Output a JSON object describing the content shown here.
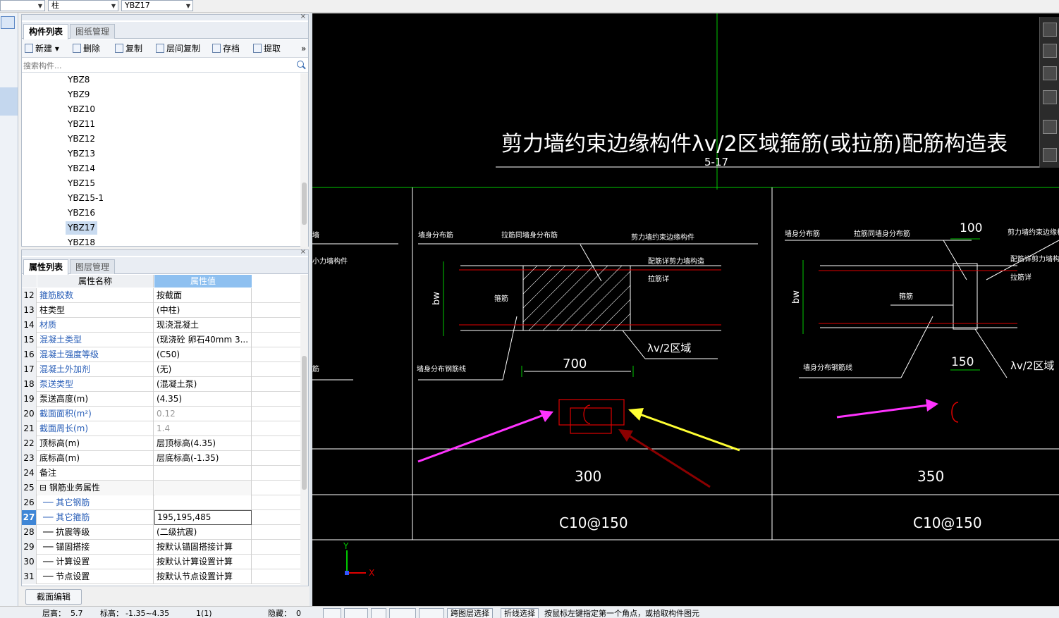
{
  "topbar": {
    "combo_floor": "",
    "combo_type": "柱",
    "combo_component": "YBZ17"
  },
  "component_panel": {
    "tabs": [
      "构件列表",
      "图纸管理"
    ],
    "toolbar": {
      "new": "新建",
      "delete": "删除",
      "copy": "复制",
      "floor_copy": "层间复制",
      "save": "存档",
      "extract": "提取",
      "more": "»"
    },
    "search_placeholder": "搜索构件...",
    "components": [
      "YBZ8",
      "YBZ9",
      "YBZ10",
      "YBZ11",
      "YBZ12",
      "YBZ13",
      "YBZ14",
      "YBZ15",
      "YBZ15-1",
      "YBZ16",
      "YBZ17",
      "YBZ18"
    ],
    "selected": "YBZ17"
  },
  "property_panel": {
    "tabs": [
      "属性列表",
      "图层管理"
    ],
    "headers": {
      "name": "属性名称",
      "value": "属性值"
    },
    "rows": [
      {
        "n": "12",
        "name": "箍筋胶数",
        "value": "按截面",
        "blue": true
      },
      {
        "n": "13",
        "name": "柱类型",
        "value": "(中柱)"
      },
      {
        "n": "14",
        "name": "材质",
        "value": "现浇混凝土",
        "blue": true
      },
      {
        "n": "15",
        "name": "混凝土类型",
        "value": "(现浇砼 卵石40mm 3...",
        "blue": true
      },
      {
        "n": "16",
        "name": "混凝土强度等级",
        "value": "(C50)",
        "blue": true
      },
      {
        "n": "17",
        "name": "混凝土外加剂",
        "value": "(无)",
        "blue": true
      },
      {
        "n": "18",
        "name": "泵送类型",
        "value": "(混凝土泵)",
        "blue": true
      },
      {
        "n": "19",
        "name": "泵送高度(m)",
        "value": "(4.35)"
      },
      {
        "n": "20",
        "name": "截面面积(m²)",
        "value": "0.12",
        "blue": true,
        "gray": true
      },
      {
        "n": "21",
        "name": "截面周长(m)",
        "value": "1.4",
        "blue": true,
        "gray": true
      },
      {
        "n": "22",
        "name": "顶标高(m)",
        "value": "层顶标高(4.35)"
      },
      {
        "n": "23",
        "name": "底标高(m)",
        "value": "层底标高(-1.35)"
      },
      {
        "n": "24",
        "name": "备注",
        "value": ""
      },
      {
        "n": "25",
        "name": "⊟ 钢筋业务属性",
        "value": "",
        "group": true
      },
      {
        "n": "26",
        "name": "── 其它钢筋",
        "value": "",
        "blue": true,
        "indent": true
      },
      {
        "n": "27",
        "name": "── 其它箍筋",
        "value": "195,195,485",
        "blue": true,
        "indent": true,
        "current": true
      },
      {
        "n": "28",
        "name": "── 抗震等级",
        "value": "(二级抗震)",
        "indent": true
      },
      {
        "n": "29",
        "name": "── 锚固搭接",
        "value": "按默认锚固搭接计算",
        "indent": true
      },
      {
        "n": "30",
        "name": "── 计算设置",
        "value": "按默认计算设置计算",
        "indent": true
      },
      {
        "n": "31",
        "name": "── 节点设置",
        "value": "按默认节点设置计算",
        "indent": true
      }
    ],
    "section_edit_button": "截面编辑"
  },
  "cad": {
    "title": "剪力墙约束边缘构件λv/2区域箍筋(或拉筋)配筋构造表",
    "subtitle": "5-17",
    "dims": {
      "d700": "700",
      "d100": "100",
      "d150": "150",
      "lv1": "λv/2区域",
      "lv2": "λv/2区域",
      "bw1": "bw",
      "bw2": "bw"
    },
    "table_values": {
      "w1": "300",
      "w2": "350",
      "r1": "C10@150",
      "r2": "C10@150"
    },
    "axis": {
      "x": "X",
      "y": "Y"
    },
    "labels_left": {
      "a": "墙身分布筋",
      "b": "拉筋同墙身分布筋",
      "c": "剪力墙约束边缘构件",
      "d": "配筋详剪力墙构造",
      "e": "拉筋详",
      "f": "箍筋",
      "g": "墙身分布钢筋线",
      "h": "小力墙构件",
      "i": "墙",
      "j": "筋"
    },
    "labels_right": {
      "a": "墙身分布筋",
      "b": "拉筋同墙身分布筋",
      "c": "剪力墙约束边缘构件",
      "d": "配筋详剪力墙构造",
      "e": "拉筋详",
      "f": "箍筋",
      "g": "墙身分布钢筋线"
    },
    "colors": {
      "grid": "#00c800",
      "white": "#ffffff",
      "red": "#e00000",
      "magenta": "#ff33ff",
      "yellow": "#ffff33",
      "darkred": "#8b0000"
    }
  },
  "status": {
    "floor_label": "层高：",
    "floor_value": "5.7",
    "elev_label": "标高：",
    "elev_value": "-1.35~4.35",
    "page": "1(1)",
    "hidden_label": "隐藏：",
    "hidden_value": "0",
    "btn1": "跨图层选择",
    "btn2": "折线选择",
    "hint": "按鼠标左键指定第一个角点，或拾取构件图元"
  }
}
